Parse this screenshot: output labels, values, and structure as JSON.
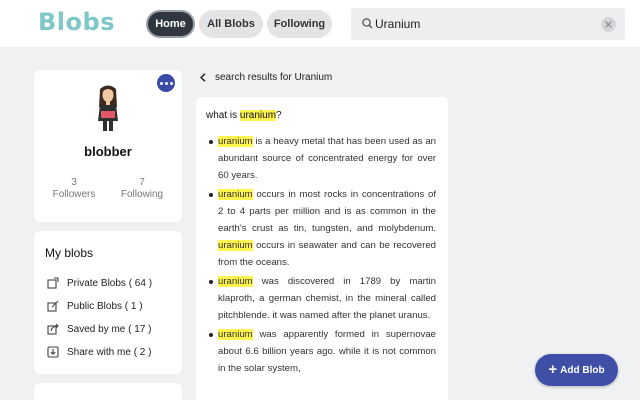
{
  "app": {
    "logo": "Blobs"
  },
  "nav": {
    "home": "Home",
    "all_blobs": "All Blobs",
    "following": "Following"
  },
  "search": {
    "value": "Uranium"
  },
  "profile": {
    "username": "blobber",
    "followers_count": "3",
    "followers_label": "Followers",
    "following_count": "7",
    "following_label": "Following"
  },
  "my_blobs": {
    "title": "My blobs",
    "items": [
      {
        "icon": "private-blob-icon",
        "label": "Private Blobs ( 64 )"
      },
      {
        "icon": "public-blob-icon",
        "label": "Public Blobs ( 1 )"
      },
      {
        "icon": "saved-icon",
        "label": "Saved by me ( 17 )"
      },
      {
        "icon": "share-icon",
        "label": "Share with me ( 2 )"
      }
    ]
  },
  "results": {
    "back_label": "search results for Uranium",
    "question_prefix": "what is ",
    "question_term": "uranium",
    "question_suffix": "?",
    "term": "uranium",
    "bullets": [
      {
        "pre": "",
        "rest": " is a heavy metal that has been used as an abundant source of concentrated energy for over 60 years."
      },
      {
        "pre": "",
        "rest": " occurs in most rocks in concentrations of 2 to 4 parts per million and is as common in the earth's crust as tin, tungsten, and molybdenum. ",
        "rest2": " occurs in seawater and can be recovered from the oceans."
      },
      {
        "pre": "",
        "rest": " was discovered in 1789 by martin klaproth, a german chemist, in the mineral called pitchblende. it was named after the planet uranus."
      },
      {
        "pre": "",
        "rest": " was apparently formed in supernovae about 6.6 billion years ago. while it is not common in the solar system,"
      }
    ]
  },
  "add_blob": {
    "label": "Add Blob"
  },
  "colors": {
    "logo": "#7fc7c9",
    "accent": "#3f4fa8",
    "highlight": "#fff34d",
    "active_pill": "#2f3640"
  }
}
